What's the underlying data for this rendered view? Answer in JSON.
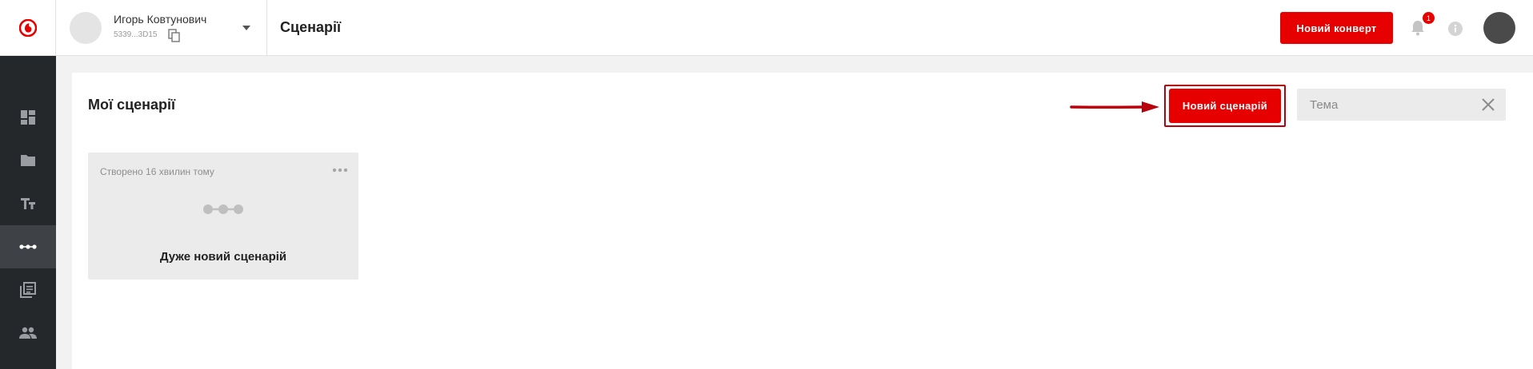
{
  "header": {
    "account_name": "Игорь Ковтунович",
    "account_id": "5339...3D15",
    "page_title": "Сценарії",
    "new_envelope_label": "Новий конверт",
    "notification_count": "1"
  },
  "sidebar": {
    "items": [
      {
        "icon": "dashboard-icon",
        "active": false
      },
      {
        "icon": "folder-icon",
        "active": false
      },
      {
        "icon": "text-fields-icon",
        "active": false
      },
      {
        "icon": "scenario-icon",
        "active": true
      },
      {
        "icon": "library-icon",
        "active": false
      },
      {
        "icon": "people-icon",
        "active": false
      }
    ]
  },
  "main": {
    "section_title": "Мої сценарії",
    "new_scenario_label": "Новий сценарій",
    "search": {
      "placeholder": "Тема",
      "value": ""
    },
    "cards": [
      {
        "created": "Створено 16 хвилин тому",
        "title": "Дуже новий сценарій"
      }
    ]
  },
  "colors": {
    "brand_red": "#e60000",
    "sidebar_bg": "#25282b",
    "annotation_red": "#b8000c"
  }
}
